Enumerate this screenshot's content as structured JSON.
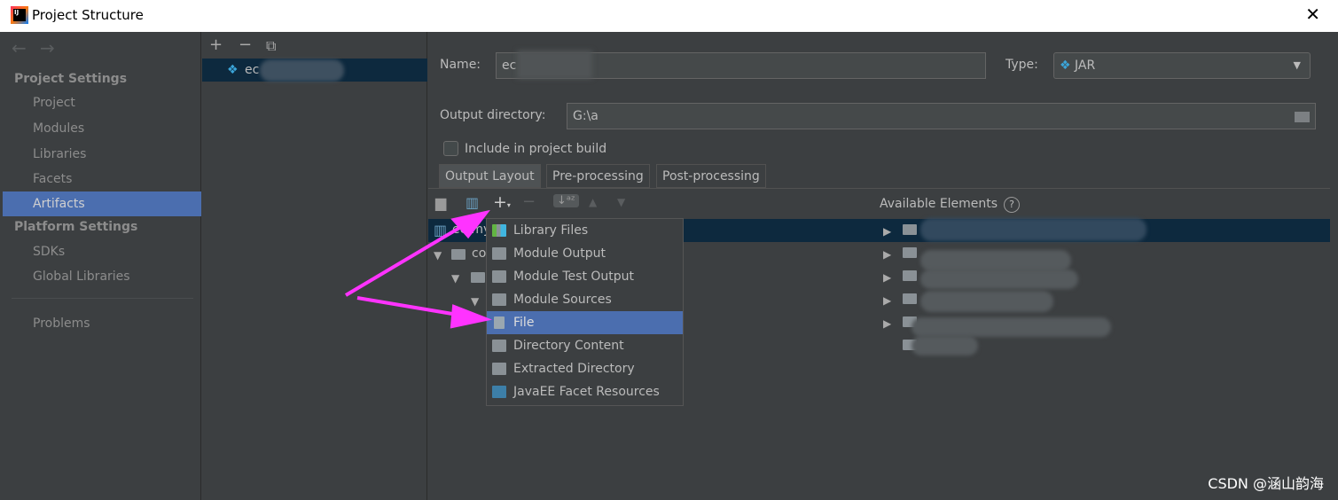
{
  "window": {
    "title": "Project Structure",
    "close": "✕",
    "logo_text": "IJ"
  },
  "sidebar": {
    "back": "←",
    "forward": "→",
    "project_settings": "Project Settings",
    "items": [
      "Project",
      "Modules",
      "Libraries",
      "Facets",
      "Artifacts"
    ],
    "platform_settings": "Platform Settings",
    "platform_items": [
      "SDKs",
      "Global Libraries"
    ],
    "problems": "Problems",
    "selected": "Artifacts"
  },
  "artifacts": {
    "add": "+",
    "remove": "−",
    "copy": "⧉",
    "item": "ec"
  },
  "form": {
    "name_label": "Name:",
    "name_value": "ec",
    "type_label": "Type:",
    "type_value": "JAR",
    "output_label": "Output directory:",
    "output_value": "G:\\a",
    "include_label": "Include in project build",
    "include_checked": false
  },
  "tabs": [
    "Output Layout",
    "Pre-processing",
    "Post-processing"
  ],
  "active_tab": "Output Layout",
  "layout": {
    "available_label": "Available Elements",
    "help": "?",
    "tree": [
      "ec-my",
      "co"
    ]
  },
  "menu": {
    "items": [
      {
        "label": "Library Files",
        "icon": "library-icon"
      },
      {
        "label": "Module Output",
        "icon": "module-output-icon"
      },
      {
        "label": "Module Test Output",
        "icon": "module-test-output-icon"
      },
      {
        "label": "Module Sources",
        "icon": "module-sources-icon"
      },
      {
        "label": "File",
        "icon": "file-icon"
      },
      {
        "label": "Directory Content",
        "icon": "directory-icon"
      },
      {
        "label": "Extracted Directory",
        "icon": "extracted-directory-icon"
      },
      {
        "label": "JavaEE Facet Resources",
        "icon": "javaee-icon"
      }
    ],
    "selected": "File"
  },
  "annotation_color": "#ff33ff",
  "watermark": "CSDN @涵山韵海"
}
